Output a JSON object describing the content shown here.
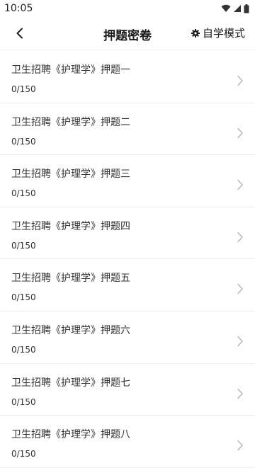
{
  "status": {
    "time": "10:05"
  },
  "header": {
    "title": "押题密卷",
    "mode_label": "自学模式"
  },
  "items": [
    {
      "title": "卫生招聘《护理学》押题一",
      "progress": "0/150"
    },
    {
      "title": "卫生招聘《护理学》押题二",
      "progress": "0/150"
    },
    {
      "title": "卫生招聘《护理学》押题三",
      "progress": "0/150"
    },
    {
      "title": "卫生招聘《护理学》押题四",
      "progress": "0/150"
    },
    {
      "title": "卫生招聘《护理学》押题五",
      "progress": "0/150"
    },
    {
      "title": "卫生招聘《护理学》押题六",
      "progress": "0/150"
    },
    {
      "title": "卫生招聘《护理学》押题七",
      "progress": "0/150"
    },
    {
      "title": "卫生招聘《护理学》押题八",
      "progress": "0/150"
    }
  ]
}
